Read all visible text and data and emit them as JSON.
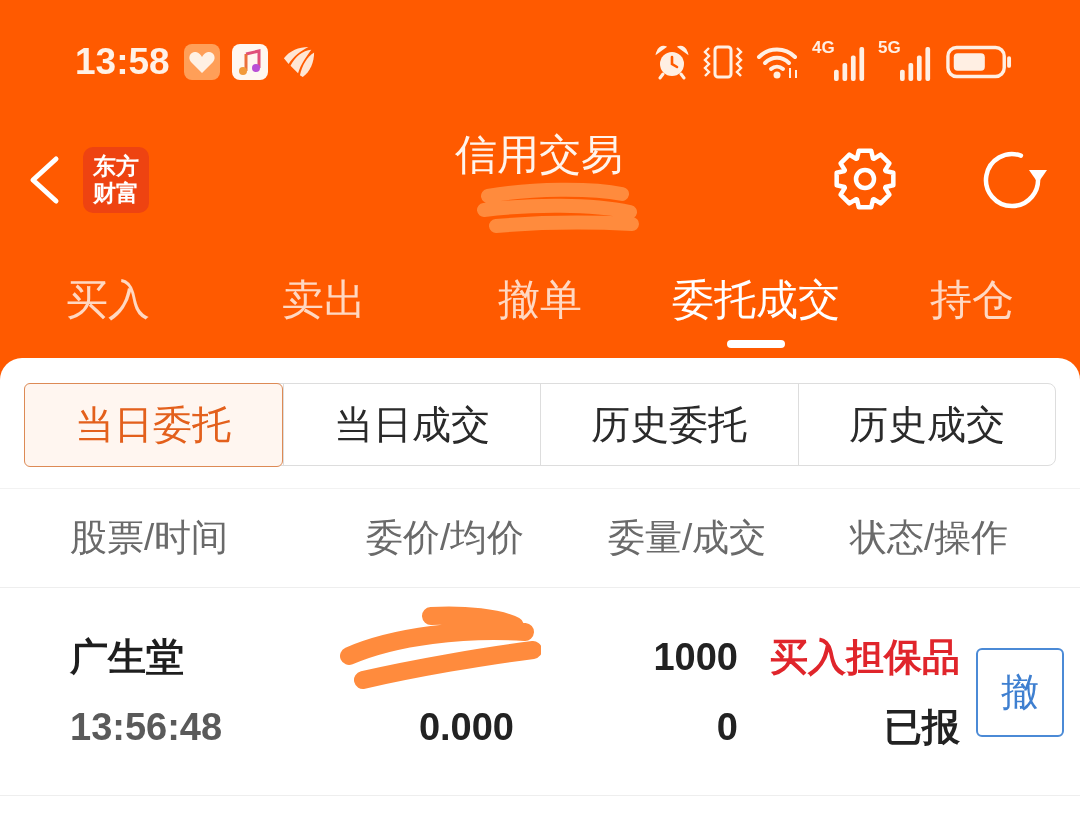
{
  "status_bar": {
    "time": "13:58",
    "network_labels": [
      "4G",
      "5G"
    ]
  },
  "header": {
    "logo_text": "东方财富",
    "title": "信用交易",
    "account_redacted": true
  },
  "tabs": [
    {
      "label": "买入",
      "selected": false
    },
    {
      "label": "卖出",
      "selected": false
    },
    {
      "label": "撤单",
      "selected": false
    },
    {
      "label": "委托成交",
      "selected": true
    },
    {
      "label": "持仓",
      "selected": false
    }
  ],
  "segments": [
    {
      "label": "当日委托",
      "selected": true
    },
    {
      "label": "当日成交",
      "selected": false
    },
    {
      "label": "历史委托",
      "selected": false
    },
    {
      "label": "历史成交",
      "selected": false
    }
  ],
  "table": {
    "columns": [
      "股票/时间",
      "委价/均价",
      "委量/成交",
      "状态/操作"
    ],
    "rows": [
      {
        "stock": "广生堂",
        "time": "13:56:48",
        "price_redacted": true,
        "avg_price": "0.000",
        "quantity": "1000",
        "filled": "0",
        "direction": "买入担保品",
        "status": "已报",
        "action": "撤"
      }
    ]
  }
}
